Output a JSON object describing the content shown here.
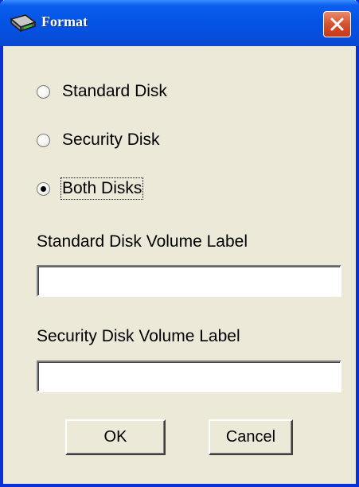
{
  "window": {
    "title": "Format",
    "title_icon": "drive-icon",
    "close_icon": "close-icon"
  },
  "format_options": [
    {
      "label": "Standard Disk",
      "checked": false
    },
    {
      "label": "Security Disk",
      "checked": false
    },
    {
      "label": "Both Disks",
      "checked": true
    }
  ],
  "fields": {
    "standard_label": "Standard Disk Volume Label",
    "standard_value": "",
    "security_label": "Security Disk Volume Label",
    "security_value": ""
  },
  "buttons": {
    "ok": "OK",
    "cancel": "Cancel"
  },
  "colors": {
    "titlebar": "#0454e4",
    "frame": "#0831d9",
    "dialog_bg": "#ece9d8",
    "close_button": "#d6522e"
  }
}
